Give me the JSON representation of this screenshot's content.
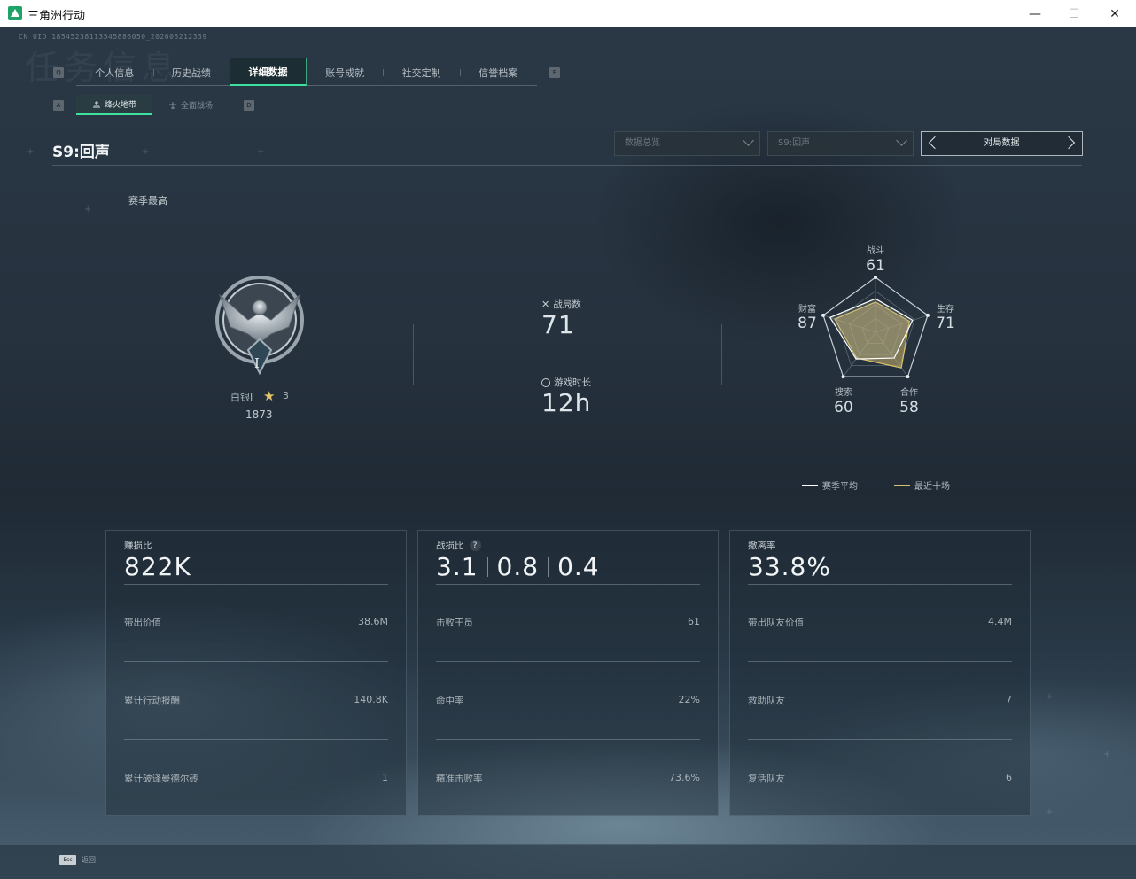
{
  "window": {
    "title": "三角洲行动",
    "minimize": "—",
    "maximize": "☐",
    "close": "✕"
  },
  "uid": "CN UID 18545238113545886050_202605212339",
  "watermark": "任务信息",
  "keys": {
    "tab_prev": "Q",
    "tab_next": "E",
    "sub_prev": "A",
    "sub_next": "D",
    "esc": "Esc"
  },
  "tabs": [
    {
      "label": "个人信息",
      "active": false
    },
    {
      "label": "历史战绩",
      "active": false
    },
    {
      "label": "详细数据",
      "active": true
    },
    {
      "label": "账号成就",
      "active": false
    },
    {
      "label": "社交定制",
      "active": false
    },
    {
      "label": "信誉档案",
      "active": false
    }
  ],
  "subtabs": [
    {
      "label": "烽火地带",
      "icon": "flame-zone-icon",
      "active": true
    },
    {
      "label": "全面战场",
      "icon": "battlefield-icon",
      "active": false
    }
  ],
  "season_title": "S9:回声",
  "dropdowns": {
    "data_type": "数据总览",
    "season": "S9:回声"
  },
  "match_data_label": "对局数据",
  "season_best_label": "赛季最高",
  "rank": {
    "name": "白银I",
    "stars": "3",
    "score": "1873",
    "numeral": "I"
  },
  "stats": {
    "matches_label": "战局数",
    "matches_value": "71",
    "playtime_label": "游戏时长",
    "playtime_value": "12h"
  },
  "radar": {
    "combat": {
      "label": "战斗",
      "value": "61"
    },
    "survival": {
      "label": "生存",
      "value": "71"
    },
    "coop": {
      "label": "合作",
      "value": "58"
    },
    "search": {
      "label": "搜索",
      "value": "60"
    },
    "wealth": {
      "label": "财富",
      "value": "87"
    },
    "season_avg": [
      61,
      71,
      58,
      60,
      87
    ],
    "recent_ten": [
      55,
      65,
      80,
      58,
      78
    ]
  },
  "legend": {
    "season_avg": "赛季平均",
    "recent_ten": "最近十场"
  },
  "colors": {
    "accent_green": "#3ee0a0",
    "recent_line": "#d9c26a",
    "season_line": "#ffffff"
  },
  "cards": [
    {
      "label": "赚损比",
      "big": "822K",
      "rows": [
        {
          "label": "带出价值",
          "value": "38.6M"
        },
        {
          "label": "累计行动报酬",
          "value": "140.8K"
        },
        {
          "label": "累计破译曼德尔砖",
          "value": "1"
        }
      ]
    },
    {
      "label": "战损比",
      "big_parts": [
        "3.1",
        "0.8",
        "0.4"
      ],
      "help": "?",
      "rows": [
        {
          "label": "击败干员",
          "value": "61"
        },
        {
          "label": "命中率",
          "value": "22%"
        },
        {
          "label": "精准击败率",
          "value": "73.6%"
        }
      ]
    },
    {
      "label": "撤离率",
      "big": "33.8%",
      "rows": [
        {
          "label": "带出队友价值",
          "value": "4.4M"
        },
        {
          "label": "救助队友",
          "value": "7"
        },
        {
          "label": "复活队友",
          "value": "6"
        }
      ]
    }
  ],
  "esc_label": "返回"
}
